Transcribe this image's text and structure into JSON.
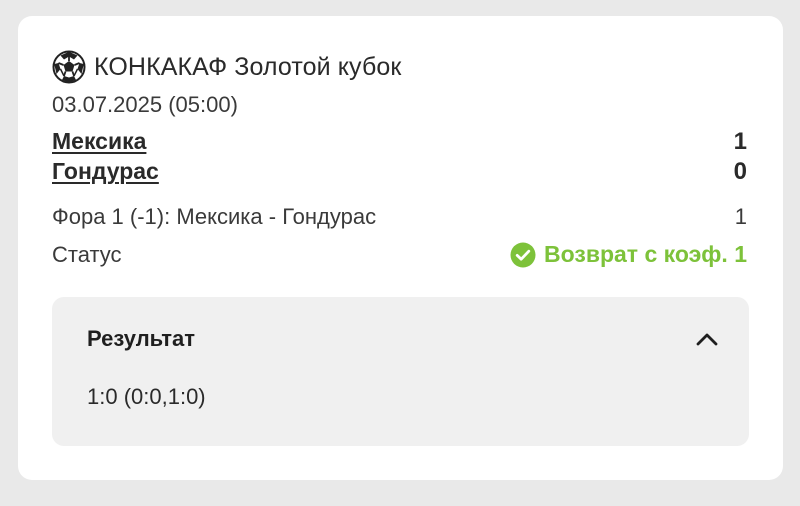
{
  "event": {
    "tournament": "КОНКАКАФ Золотой кубок",
    "tournament_icon": "soccer-ball-icon",
    "date": "03.07.2025 (05:00)"
  },
  "teams": [
    {
      "name": "Мексика",
      "score": "1"
    },
    {
      "name": "Гондурас",
      "score": "0"
    }
  ],
  "bet": {
    "label": "Фора 1 (-1): Мексика - Гондурас",
    "value": "1"
  },
  "status": {
    "label": "Статус",
    "value": "Возврат с коэф. 1",
    "color": "#7dc23a",
    "icon": "check-circle-icon"
  },
  "result": {
    "title": "Результат",
    "value": "1:0 (0:0,1:0)",
    "expanded": true,
    "toggle_icon": "chevron-up-icon"
  }
}
